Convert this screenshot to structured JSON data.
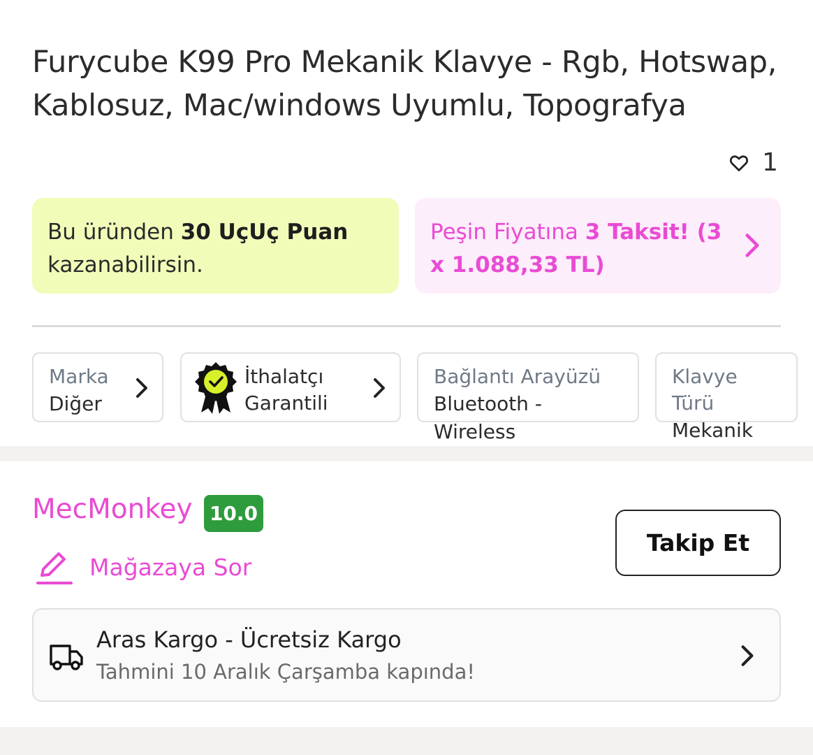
{
  "product": {
    "title": "Furycube K99 Pro Mekanik Klavye - Rgb, Hotswap, Kablosuz, Mac/windows Uyumlu, Topografya",
    "like_count": "1"
  },
  "promos": {
    "points_prefix": "Bu üründen ",
    "points_bold": "30 UçUç Puan",
    "points_suffix": "kazanabilirsin.",
    "install_prefix": "Peşin Fiyatına ",
    "install_bold": "3 Taksit! (3 x 1.088,33 TL)"
  },
  "attributes": {
    "brand": {
      "label": "Marka",
      "value": "Diğer"
    },
    "importer": {
      "line1": "İthalatçı",
      "line2": "Garantili"
    },
    "connection": {
      "label": "Bağlantı Arayüzü",
      "value": "Bluetooth - Wireless"
    },
    "keyboard_type": {
      "label": "Klavye Türü",
      "value": "Mekanik"
    }
  },
  "seller": {
    "name": "MecMonkey",
    "score": "10.0",
    "ask_label": "Mağazaya Sor",
    "follow_label": "Takip Et"
  },
  "shipping": {
    "title": "Aras Kargo - Ücretsiz Kargo",
    "subtitle": "Tahmini 10 Aralık Çarşamba kapında!"
  },
  "colors": {
    "accent_pink": "#e94bd4",
    "score_green": "#2e9c3d",
    "points_bg": "#f2fcb9",
    "install_bg": "#fdeefb"
  }
}
